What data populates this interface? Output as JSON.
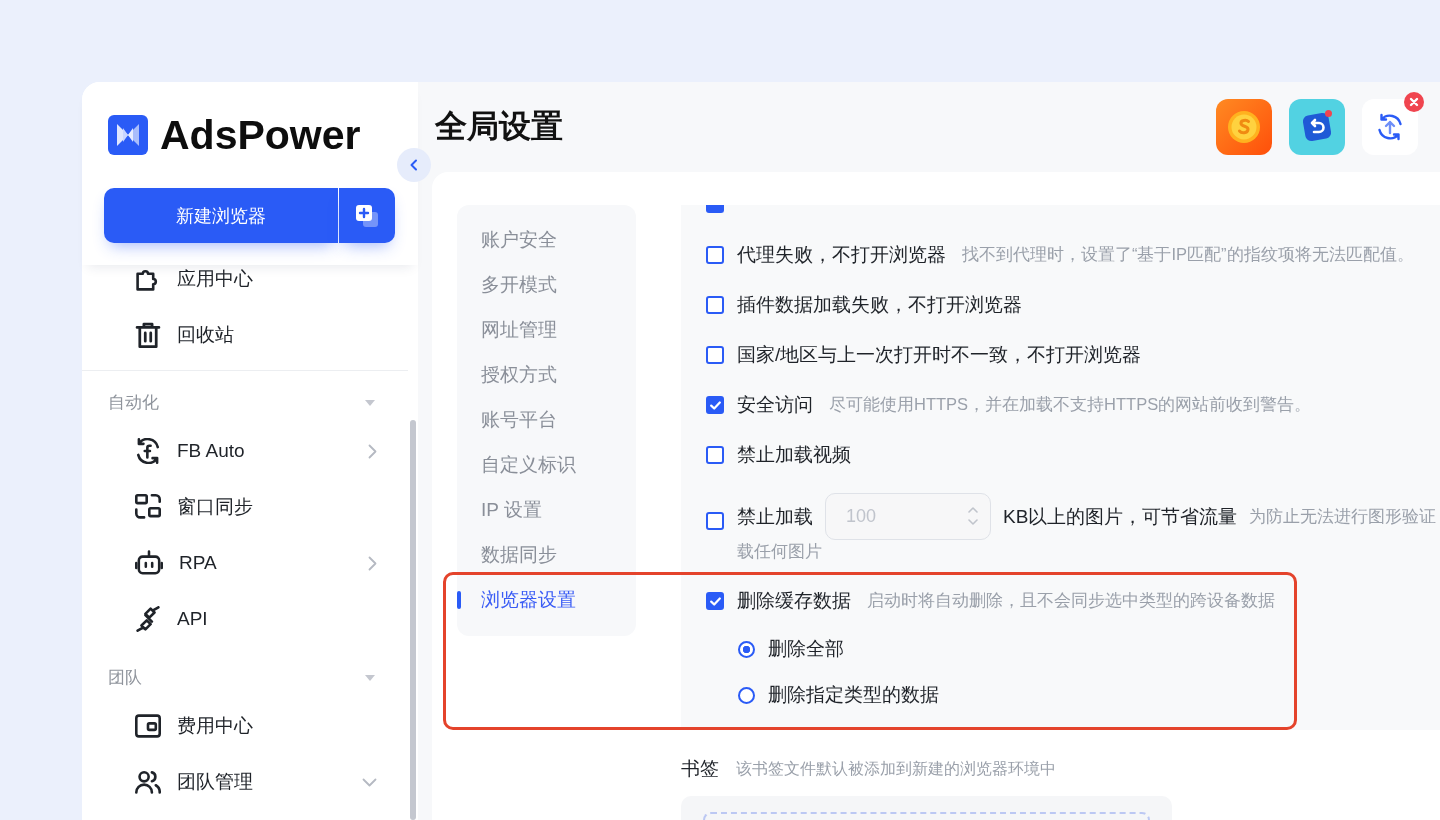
{
  "header": {
    "title": "全局设置"
  },
  "toolbar_buttons": [
    {
      "notification_dot": false,
      "close_badge": false
    },
    {
      "notification_dot": true,
      "close_badge": false
    },
    {
      "notification_dot": false,
      "close_badge": true
    }
  ],
  "sidebar": {
    "brand": "AdsPower",
    "new_button": "新建浏览器",
    "sections": [
      {
        "items": [
          {
            "kind": "link",
            "label": "应用中心"
          },
          {
            "kind": "link",
            "label": "回收站"
          }
        ]
      },
      {
        "title": "自动化",
        "expanded": true,
        "items": [
          {
            "kind": "submenu",
            "label": "FB Auto"
          },
          {
            "kind": "link",
            "label": "窗口同步"
          },
          {
            "kind": "submenu",
            "label": "RPA"
          },
          {
            "kind": "link",
            "label": "API"
          }
        ]
      },
      {
        "title": "团队",
        "expanded": true,
        "items": [
          {
            "kind": "link",
            "label": "费用中心"
          },
          {
            "kind": "group",
            "label": "团队管理",
            "expanded": false
          }
        ]
      }
    ]
  },
  "settings_nav": [
    {
      "label": "账户安全",
      "selected": false
    },
    {
      "label": "多开模式",
      "selected": false
    },
    {
      "label": "网址管理",
      "selected": false
    },
    {
      "label": "授权方式",
      "selected": false
    },
    {
      "label": "账号平台",
      "selected": false
    },
    {
      "label": "自定义标识",
      "selected": false
    },
    {
      "label": "IP 设置",
      "selected": false
    },
    {
      "label": "数据同步",
      "selected": false
    },
    {
      "label": "浏览器设置",
      "selected": true
    }
  ],
  "browser_settings": {
    "options": [
      {
        "kind": "cut-checkbox",
        "checked": true
      },
      {
        "kind": "checkbox",
        "checked": false,
        "label": "代理失败，不打开浏览器",
        "description": "找不到代理时，设置了“基于IP匹配”的指纹项将无法匹配值。"
      },
      {
        "kind": "checkbox",
        "checked": false,
        "label": "插件数据加载失败，不打开浏览器"
      },
      {
        "kind": "checkbox",
        "checked": false,
        "label": "国家/地区与上一次打开时不一致，不打开浏览器"
      },
      {
        "kind": "checkbox",
        "checked": true,
        "label": "安全访问",
        "description": "尽可能使用HTTPS，并在加载不支持HTTPS的网站前收到警告。"
      },
      {
        "kind": "checkbox",
        "checked": false,
        "label": "禁止加载视频"
      },
      {
        "kind": "size-limit",
        "checked": false,
        "label": "禁止加载",
        "value": "100",
        "disabled": true,
        "unit_label": "KB以上的图片，可节省流量",
        "description": "为防止无法进行图形验证",
        "description_line_2": "载任何图片"
      },
      {
        "kind": "checkbox",
        "checked": true,
        "label": "删除缓存数据",
        "description": "启动时将自动删除，且不会同步选中类型的跨设备数据"
      },
      {
        "kind": "radio",
        "selected": true,
        "label": "删除全部"
      },
      {
        "kind": "radio",
        "selected": false,
        "label": "删除指定类型的数据"
      }
    ]
  },
  "bookmarks": {
    "label": "书签",
    "description": "该书签文件默认被添加到新建的浏览器环境中"
  },
  "annotations": [
    {
      "kind": "frame"
    }
  ]
}
